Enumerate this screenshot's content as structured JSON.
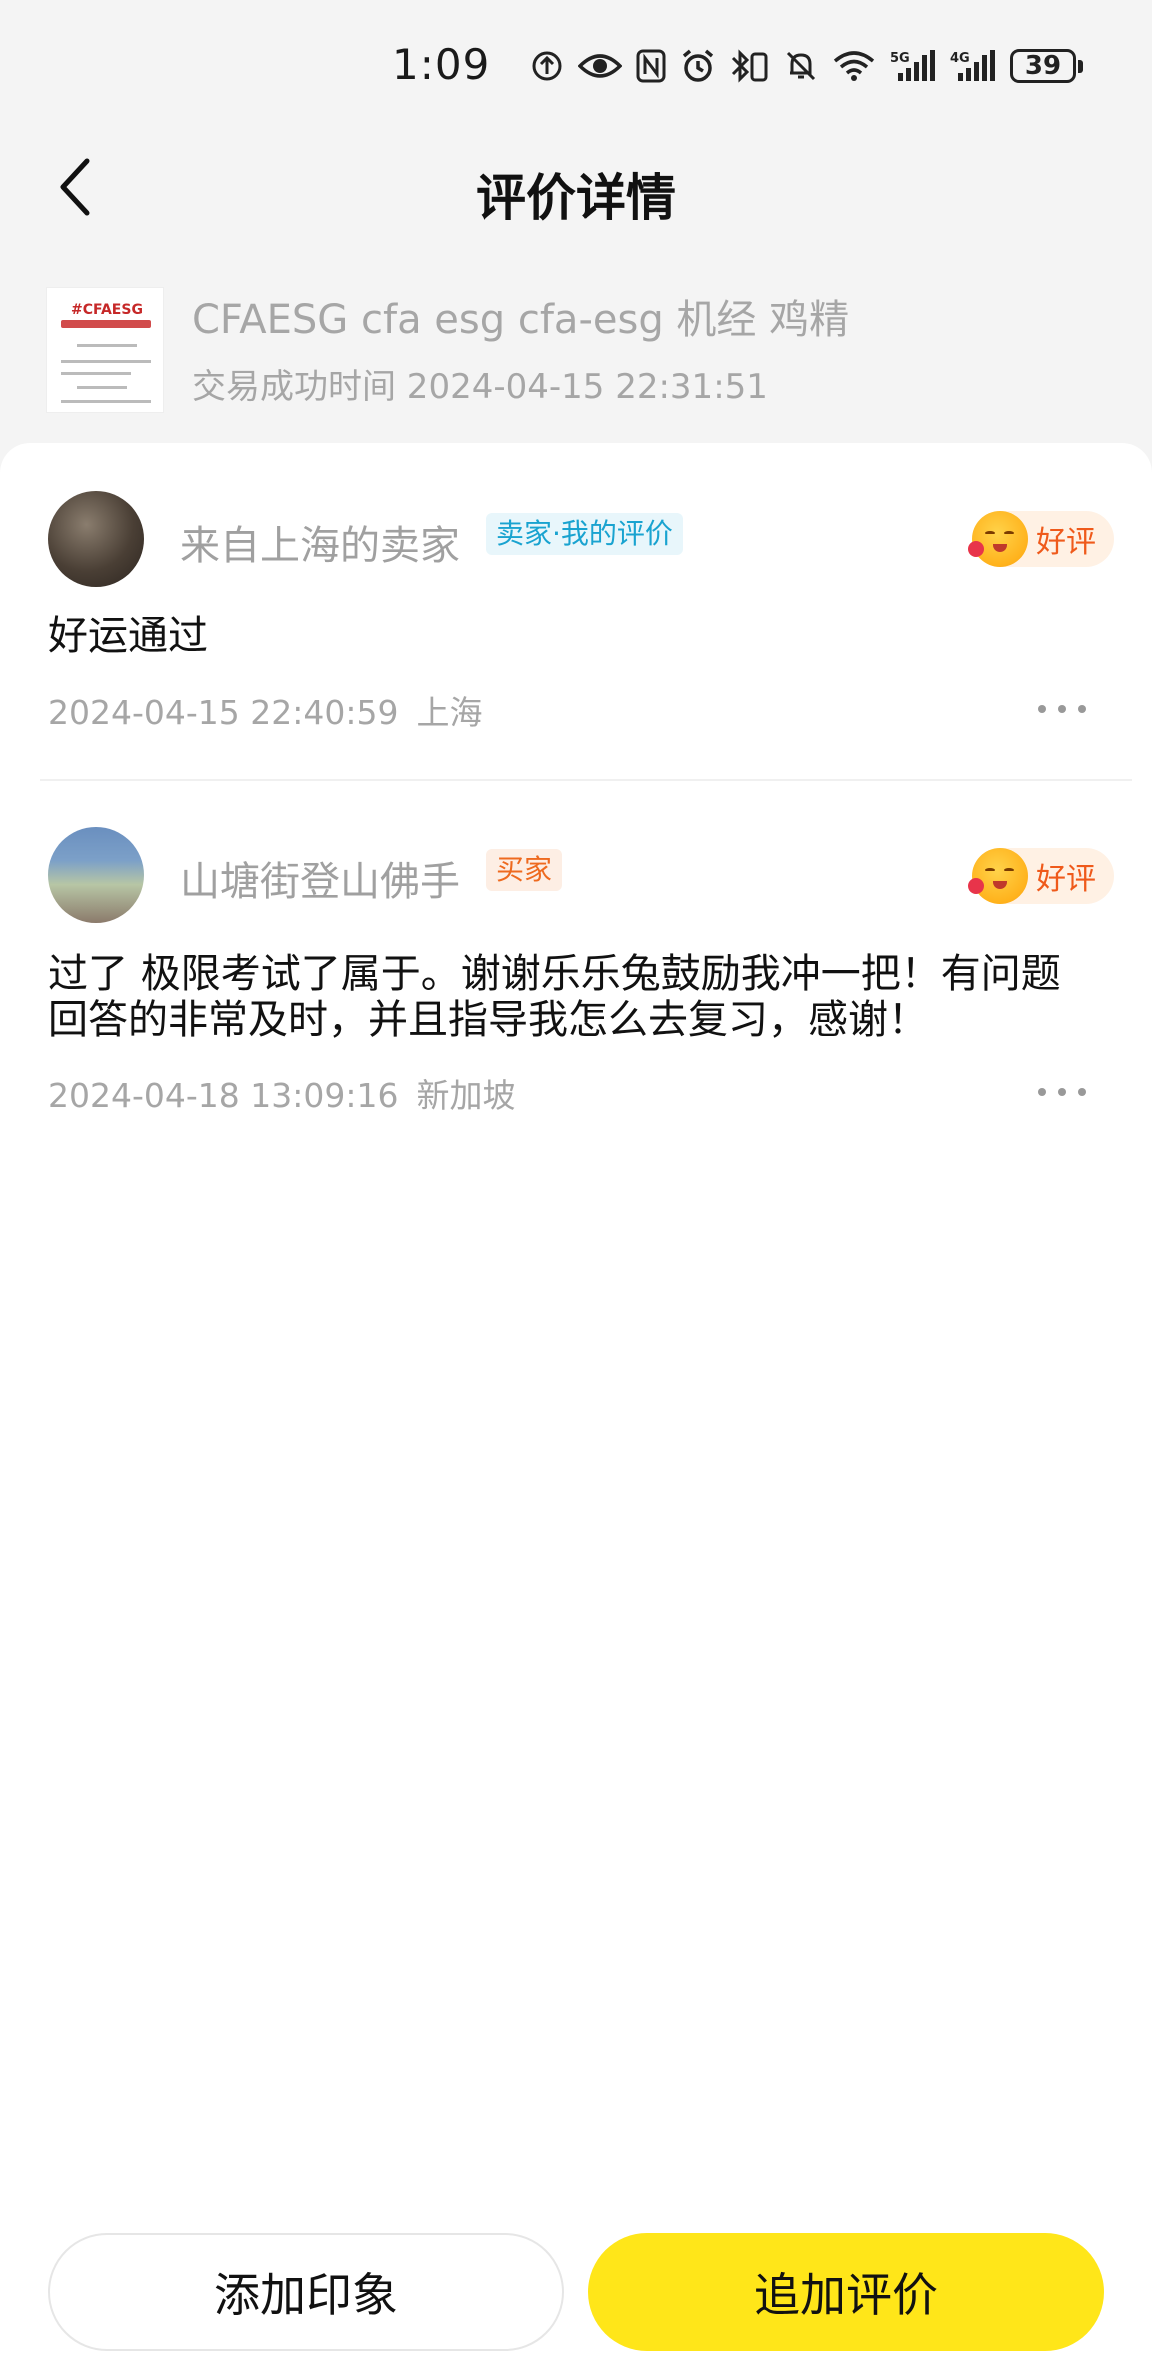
{
  "status_bar": {
    "time": "1:09",
    "battery": "39"
  },
  "header": {
    "title": "评价详情"
  },
  "product": {
    "thumb_text": "#CFAESG",
    "title": "CFAESG cfa esg cfa-esg 机经 鸡精",
    "trade_time": "交易成功时间 2024-04-15 22:31:51"
  },
  "reviews": [
    {
      "name": "来自上海的卖家",
      "tag": "卖家·我的评价",
      "rating": "好评",
      "text": "好运通过",
      "date": "2024-04-15 22:40:59",
      "location": "上海"
    },
    {
      "name": "山塘街登山佛手",
      "tag": "买家",
      "rating": "好评",
      "text": "过了 极限考试了属于。谢谢乐乐兔鼓励我冲一把！有问题回答的非常及时，并且指导我怎么去复习，感谢！",
      "date": "2024-04-18 13:09:16",
      "location": "新加坡"
    }
  ],
  "bottom": {
    "impression_label": "添加印象",
    "add_review_label": "追加评价"
  },
  "colors": {
    "primary_yellow": "#ffe619",
    "seller_tag": "#19a3d0",
    "buyer_tag": "#ee6a1f",
    "rating": "#ef5a1b"
  }
}
